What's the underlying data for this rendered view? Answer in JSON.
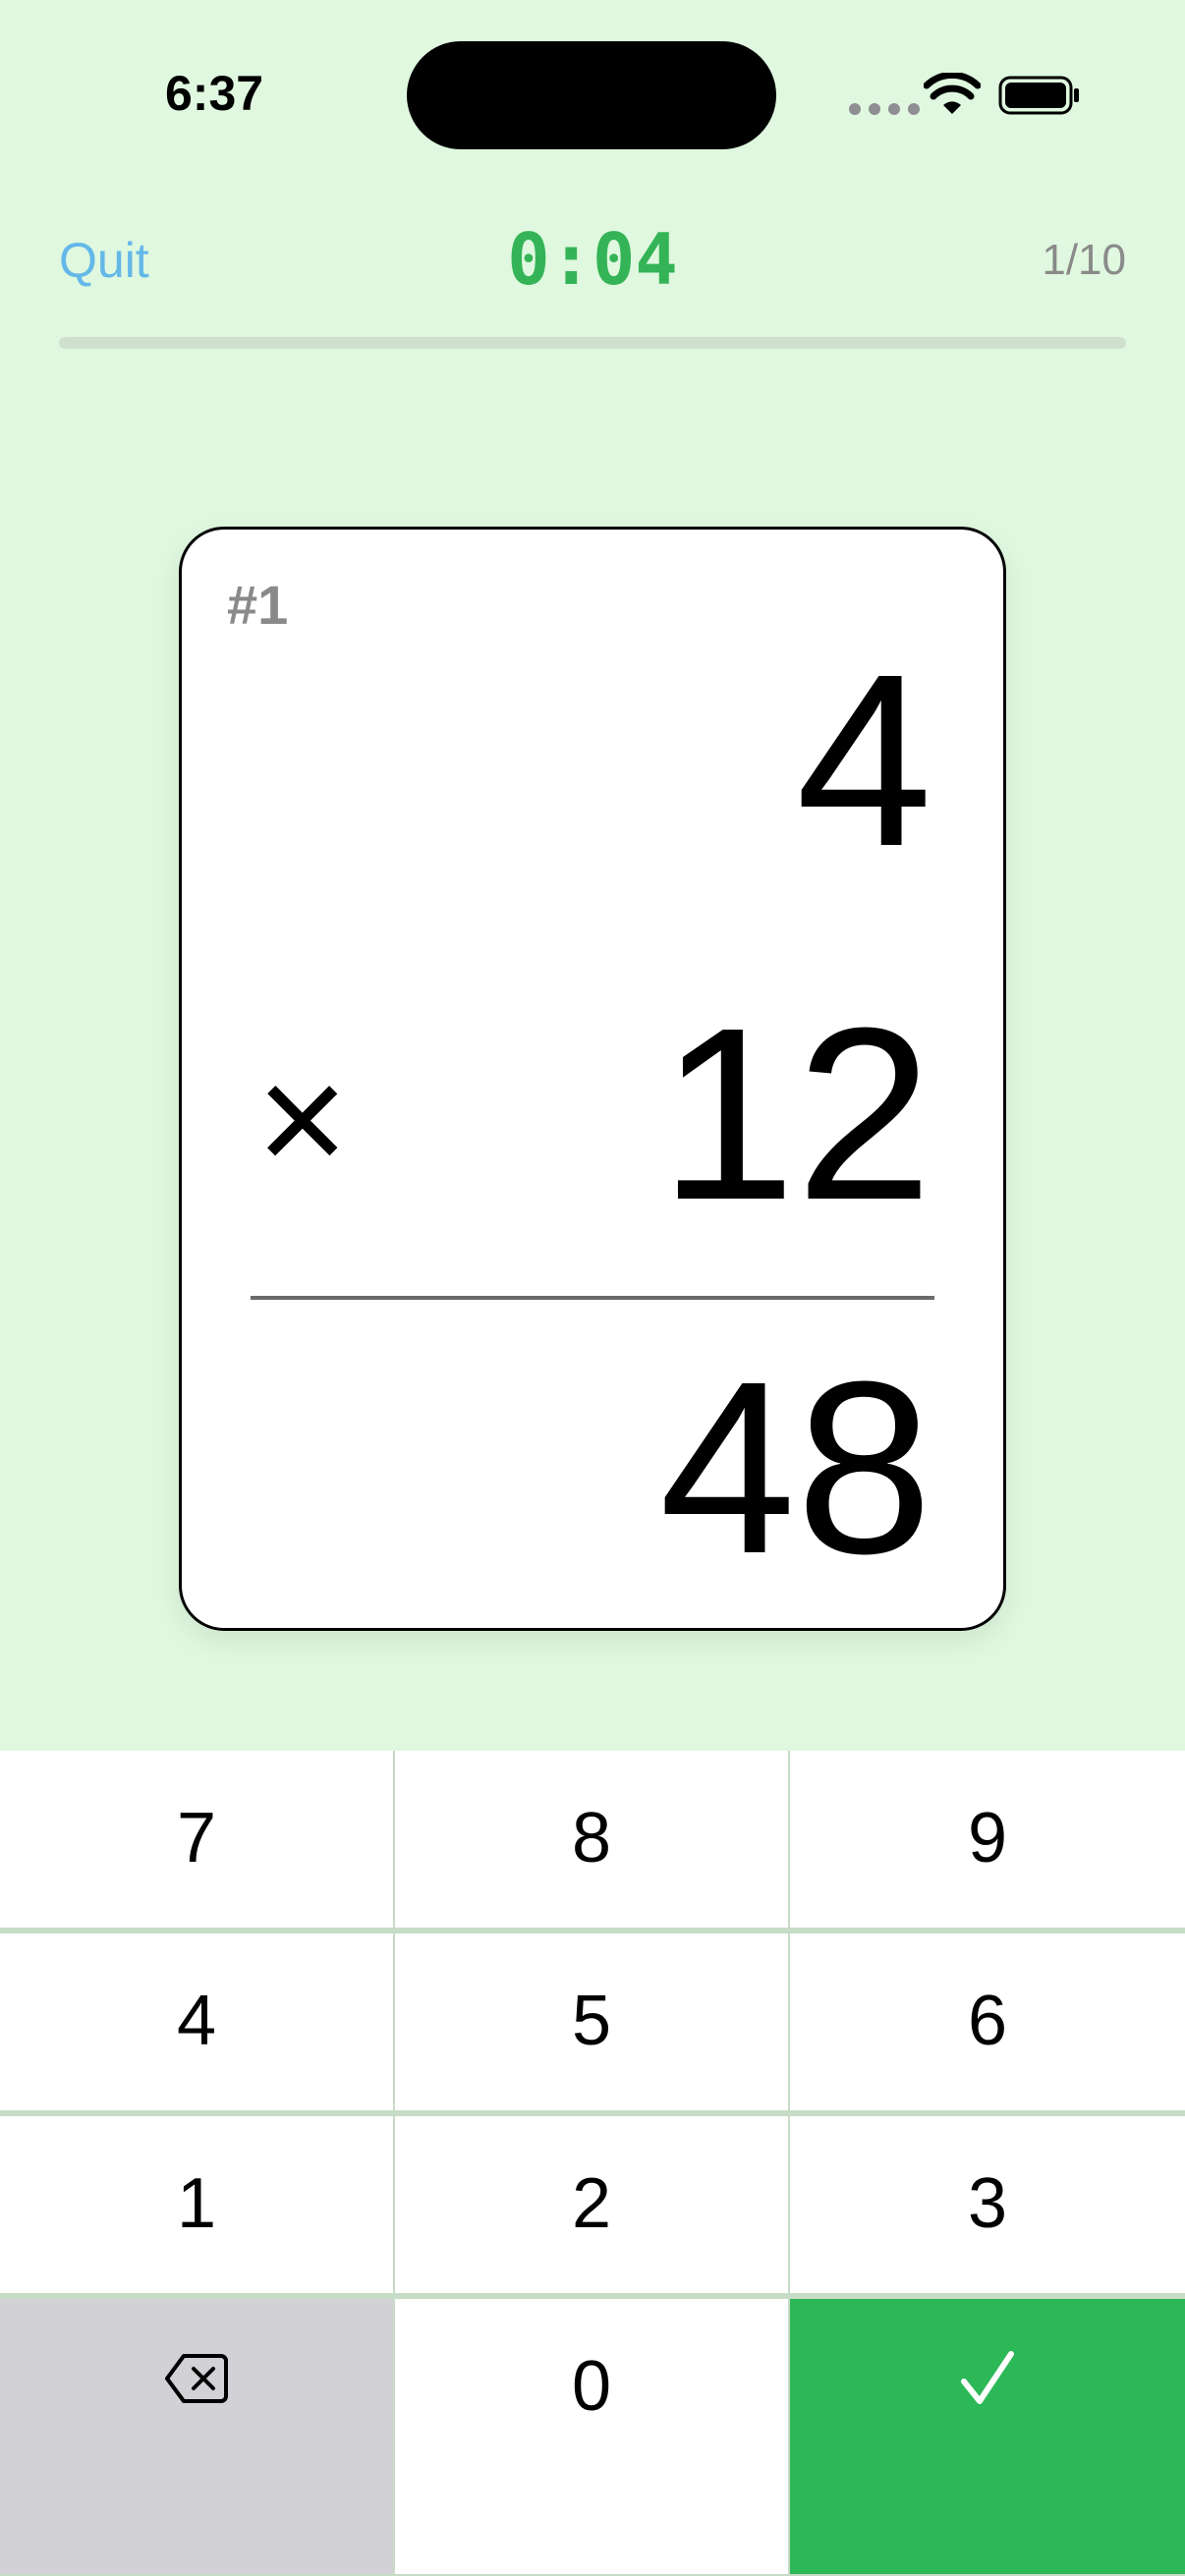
{
  "status_bar": {
    "time": "6:37"
  },
  "header": {
    "quit_label": "Quit",
    "timer": "0:04",
    "progress_text": "1/10",
    "progress_fraction": 0.0
  },
  "card": {
    "number_label": "#1",
    "operand_top": "4",
    "operator": "×",
    "operand_bottom": "12",
    "answer": "48"
  },
  "keypad": {
    "keys": [
      "7",
      "8",
      "9",
      "4",
      "5",
      "6",
      "1",
      "2",
      "3",
      "0"
    ],
    "delete_icon": "backspace-icon",
    "submit_icon": "checkmark-icon"
  },
  "colors": {
    "background": "#dff8df",
    "accent_green": "#34b456",
    "quit_blue": "#64b8e8",
    "submit_green": "#2db857",
    "delete_gray": "#d1d1d6"
  }
}
